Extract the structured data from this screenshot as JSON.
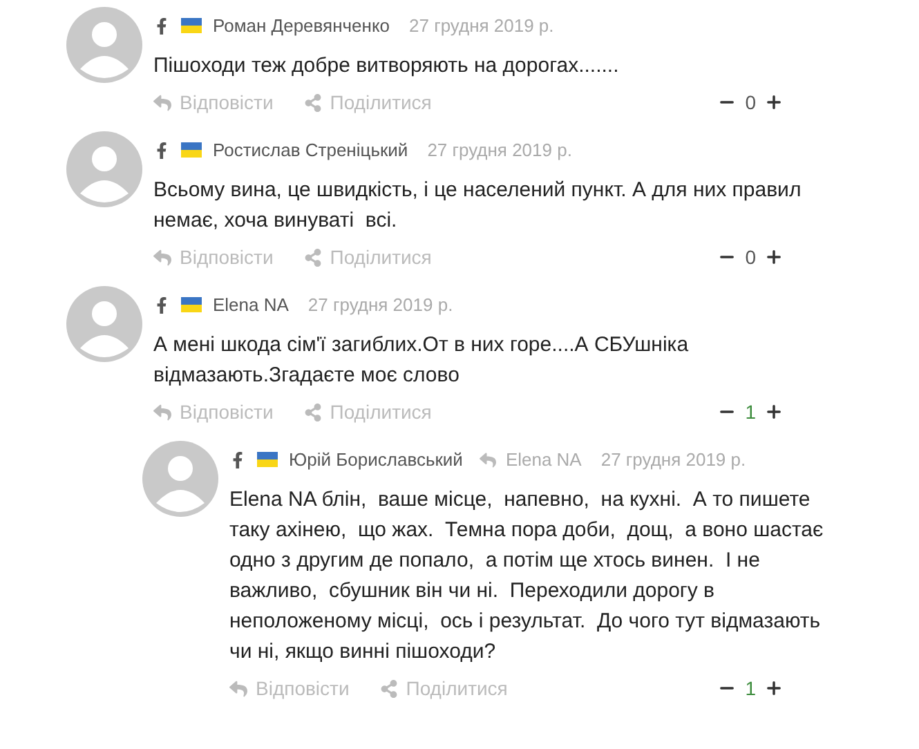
{
  "comments": [
    {
      "author": "Роман Деревянченко",
      "date": "27 грудня 2019 р.",
      "text": "Пішоходи теж добре витворяють на дорогах.......",
      "reply_label": "Відповісти",
      "share_label": "Поділитися",
      "score": {
        "value": "0",
        "color": "#555555"
      }
    },
    {
      "author": "Ростислав Стреніцький",
      "date": "27 грудня 2019 р.",
      "text": "Всьому вина, це швидкість, і це населений пункт. А для них правил немає, хоча винуваті  всі.",
      "reply_label": "Відповісти",
      "share_label": "Поділитися",
      "score": {
        "value": "0",
        "color": "#555555"
      }
    },
    {
      "author": "Elena NA",
      "date": "27 грудня 2019 р.",
      "text": "А мені шкода сім'ї загиблих.От в них горе....А СБУшніка відмазають.Згадаєте моє слово",
      "reply_label": "Відповісти",
      "share_label": "Поділитися",
      "score": {
        "value": "1",
        "color": "#3c8c3c"
      },
      "children": [
        {
          "author": "Юрій Бориславський",
          "reply_to": "Elena NA",
          "date": "27 грудня 2019 р.",
          "text": "Elena NA блін,  ваше місце,  напевно,  на кухні.  А то пишете таку ахінею,  що жах.  Темна пора доби,  дощ,  а воно шастає одно з другим де попало,  а потім ще хтось винен.  І не важливо,  сбушник він чи ні.  Переходили дорогу в неположеному місці,  ось і результат.  До чого тут відмазають  чи ні, якщо винні пішоходи?",
          "reply_label": "Відповісти",
          "share_label": "Поділитися",
          "score": {
            "value": "1",
            "color": "#3c8c3c"
          }
        }
      ]
    }
  ]
}
